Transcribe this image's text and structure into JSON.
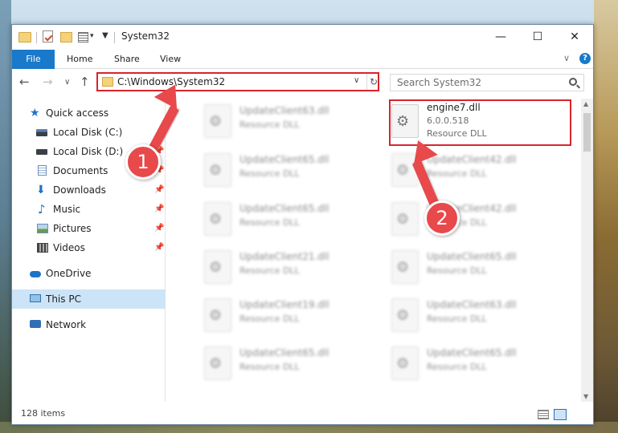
{
  "window": {
    "title": "System32",
    "controls": {
      "minimize": "—",
      "maximize": "☐",
      "close": "✕"
    }
  },
  "ribbon": {
    "tabs": [
      {
        "label": "File"
      },
      {
        "label": "Home"
      },
      {
        "label": "Share"
      },
      {
        "label": "View"
      }
    ],
    "help": "?"
  },
  "address_bar": {
    "path": "C:\\Windows\\System32"
  },
  "search": {
    "placeholder": "Search System32"
  },
  "sidebar": {
    "items": [
      {
        "label": "Quick access",
        "icon": "star-icon"
      },
      {
        "label": "Local Disk (C:)",
        "icon": "drive-icon"
      },
      {
        "label": "Local Disk (D:)",
        "icon": "drive-icon"
      },
      {
        "label": "Documents",
        "icon": "documents-icon"
      },
      {
        "label": "Downloads",
        "icon": "downloads-icon"
      },
      {
        "label": "Music",
        "icon": "music-icon"
      },
      {
        "label": "Pictures",
        "icon": "pictures-icon"
      },
      {
        "label": "Videos",
        "icon": "videos-icon"
      },
      {
        "label": "OneDrive",
        "icon": "cloud-icon"
      },
      {
        "label": "This PC",
        "icon": "computer-icon"
      },
      {
        "label": "Network",
        "icon": "network-icon"
      }
    ]
  },
  "files": {
    "left_column": [
      {
        "name": "UpdateClient63.dll",
        "type": "Resource DLL"
      },
      {
        "name": "UpdateClient65.dll",
        "type": "Resource DLL"
      },
      {
        "name": "UpdateClient65.dll",
        "type": "Resource DLL"
      },
      {
        "name": "UpdateClient21.dll",
        "type": "Resource DLL"
      },
      {
        "name": "UpdateClient19.dll",
        "type": "Resource DLL"
      },
      {
        "name": "UpdateClient65.dll",
        "type": "Resource DLL"
      }
    ],
    "highlighted": {
      "name": "engine7.dll",
      "version": "6.0.0.518",
      "type": "Resource DLL"
    },
    "right_column": [
      {
        "name": "UpdateClient42.dll",
        "type": "Resource DLL"
      },
      {
        "name": "UpdateClient42.dll",
        "type": "Resource DLL"
      },
      {
        "name": "UpdateClient65.dll",
        "type": "Resource DLL"
      },
      {
        "name": "UpdateClient63.dll",
        "type": "Resource DLL"
      },
      {
        "name": "UpdateClient65.dll",
        "type": "Resource DLL"
      }
    ]
  },
  "status": {
    "item_count": "128 items"
  },
  "annotations": {
    "step1": "1",
    "step2": "2",
    "color": "#e8494b"
  }
}
